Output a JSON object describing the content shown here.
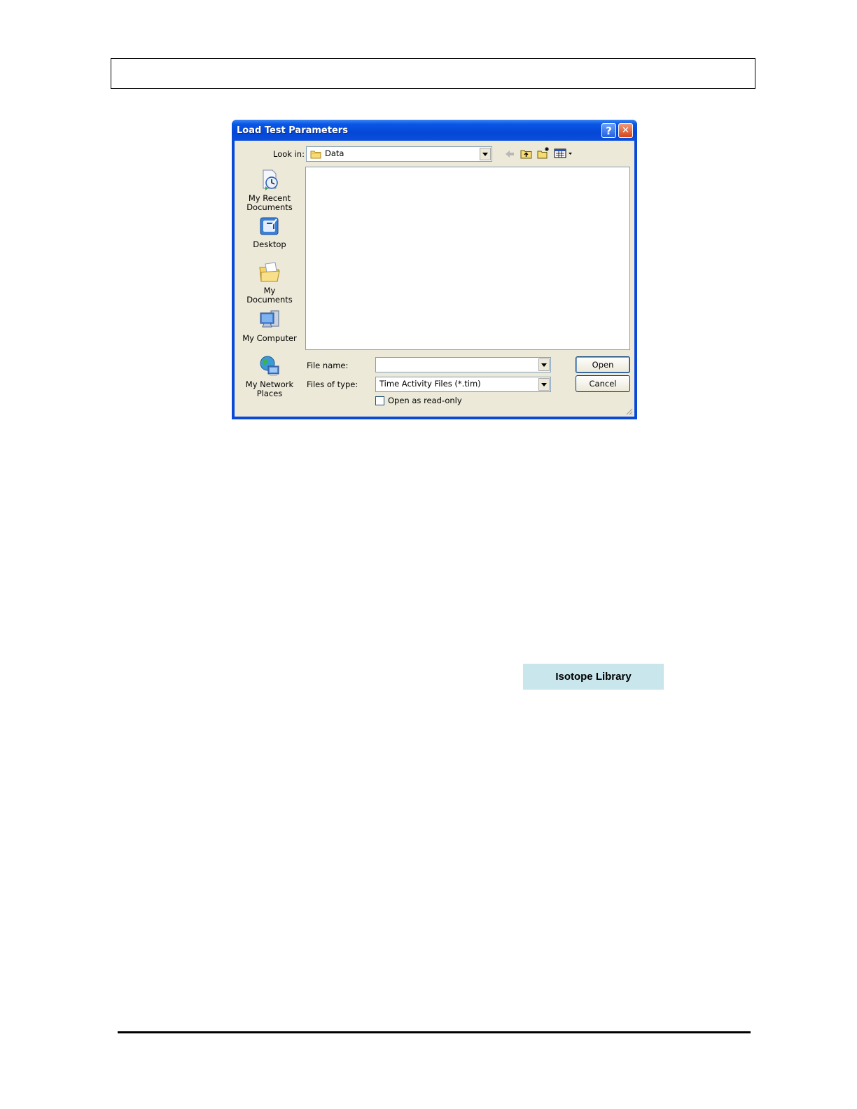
{
  "dialog": {
    "title": "Load Test Parameters",
    "look_in_label": "Look in:",
    "look_in_value": "Data",
    "places": [
      {
        "label": "My Recent\nDocuments"
      },
      {
        "label": "Desktop"
      },
      {
        "label": "My Documents"
      },
      {
        "label": "My Computer"
      },
      {
        "label": "My Network\nPlaces"
      }
    ],
    "file_name_label": "File name:",
    "file_name_value": "",
    "files_of_type_label": "Files of type:",
    "files_of_type_value": "Time Activity Files (*.tim)",
    "read_only_label": "Open as read-only",
    "open_label": "Open",
    "cancel_label": "Cancel",
    "help_glyph": "?",
    "close_glyph": "✕"
  },
  "isotope_button": {
    "label": "Isotope Library"
  },
  "colors": {
    "title_bar": "#0a4fdc",
    "dialog_face": "#ece9d8",
    "isotope_button_bg": "#c8e6ec"
  }
}
